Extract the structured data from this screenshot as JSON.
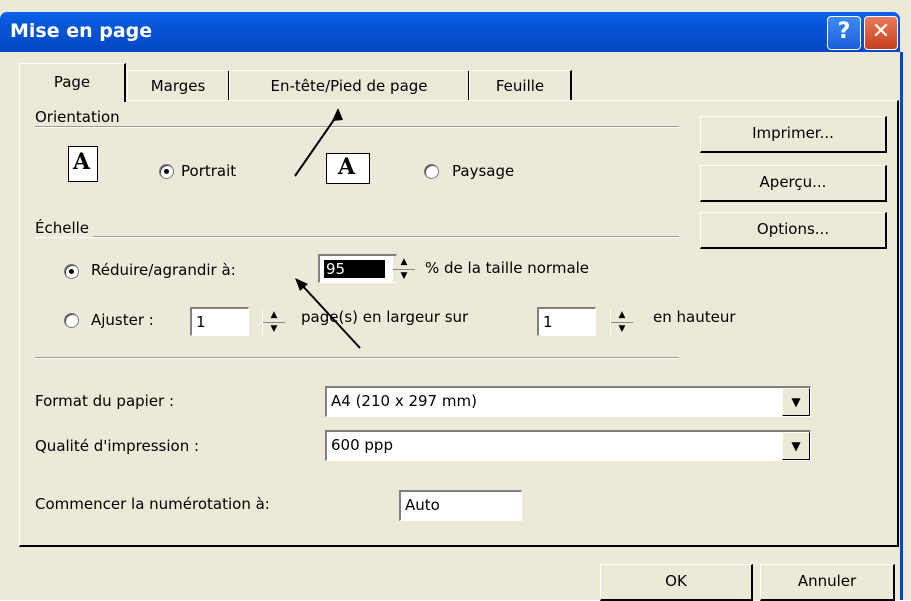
{
  "window": {
    "title": "Mise en page",
    "help_label": "?",
    "close_label": "✕"
  },
  "tabs": [
    {
      "label": "Page",
      "active": true
    },
    {
      "label": "Marges",
      "active": false
    },
    {
      "label": "En-tête/Pied de page",
      "active": false
    },
    {
      "label": "Feuille",
      "active": false
    }
  ],
  "orientation": {
    "label": "Orientation",
    "icon_letter": "A",
    "portrait_label": "Portrait",
    "landscape_label": "Paysage",
    "selected": "portrait"
  },
  "scale": {
    "label": "Échelle",
    "reduce_label": "Réduire/agrandir à:",
    "reduce_value": "95",
    "reduce_suffix": "% de la taille normale",
    "fit_label": "Ajuster :",
    "fit_width_value": "1",
    "fit_width_suffix": "page(s) en largeur sur",
    "fit_height_value": "1",
    "fit_height_suffix": "en hauteur",
    "selected": "reduce"
  },
  "paper": {
    "label": "Format du papier :",
    "value": "A4 (210 x 297 mm)"
  },
  "quality": {
    "label": "Qualité d'impression :",
    "value": "600 ppp"
  },
  "numbering": {
    "label": "Commencer la numérotation à:",
    "value": "Auto"
  },
  "side_buttons": {
    "print": "Imprimer...",
    "preview": "Aperçu...",
    "options": "Options..."
  },
  "footer": {
    "ok": "OK",
    "cancel": "Annuler"
  },
  "icons": {
    "help": "help-icon",
    "close": "close-icon",
    "spin": "spin-arrows-icon",
    "dropdown": "chevron-down-icon"
  }
}
